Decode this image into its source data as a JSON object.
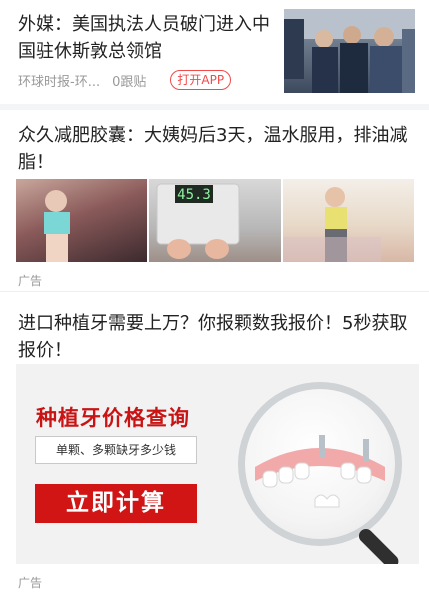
{
  "news_item": {
    "title": "外媒：美国执法人员破门进入中国驻休斯敦总领馆",
    "source": "环球时报-环...",
    "comments": "0跟贴",
    "open_app_label": "打开APP"
  },
  "ad_item_1": {
    "title": " 众久减肥胶囊：大姨妈后3天，温水服用，排油减脂！",
    "scale_reading": "45.3",
    "ad_label": "广告"
  },
  "ad_item_2": {
    "title": "进口种植牙需要上万？你报颗数我报价！5秒获取报价！",
    "banner_headline": "种植牙价格查询",
    "banner_subtext": "单颗、多颗缺牙多少钱",
    "banner_cta": "立即计算",
    "ad_label": "广告"
  }
}
